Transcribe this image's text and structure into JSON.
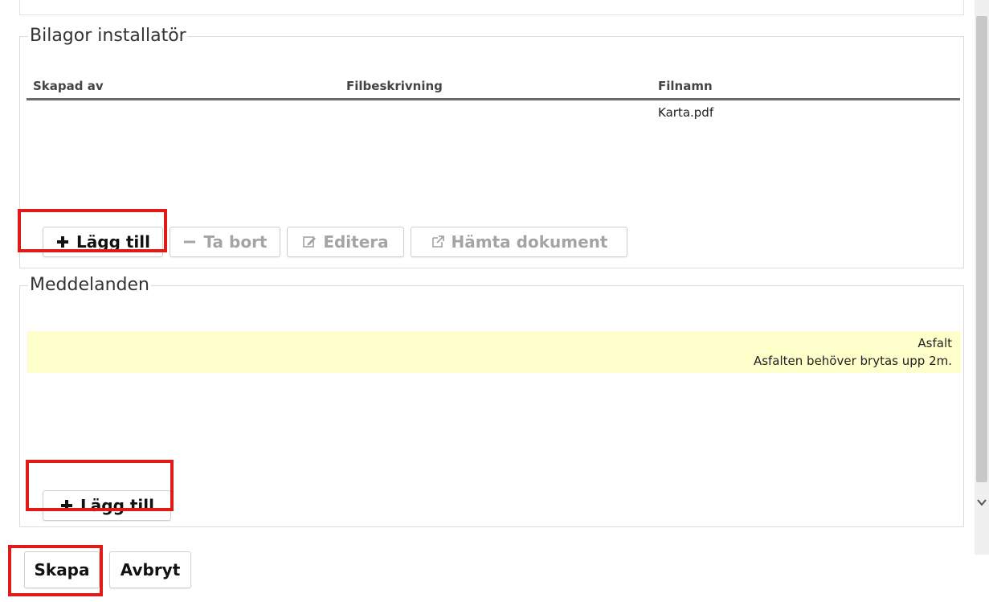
{
  "attachments": {
    "legend": "Bilagor installatör",
    "columns": [
      "Skapad av",
      "Filbeskrivning",
      "Filnamn"
    ],
    "rows": [
      {
        "created_by": "",
        "description": "",
        "filename": "Karta.pdf"
      }
    ],
    "buttons": {
      "add": "Lägg till",
      "remove": "Ta bort",
      "edit": "Editera",
      "download": "Hämta dokument"
    }
  },
  "messages": {
    "legend": "Meddelanden",
    "items": [
      {
        "title": "Asfalt",
        "text": "Asfalten behöver brytas upp 2m."
      }
    ],
    "add_button": "Lägg till"
  },
  "footer": {
    "create_button": "Skapa",
    "cancel_button": "Avbryt"
  },
  "colors": {
    "highlight": "#e01919",
    "message_background": "#ffffcc"
  }
}
